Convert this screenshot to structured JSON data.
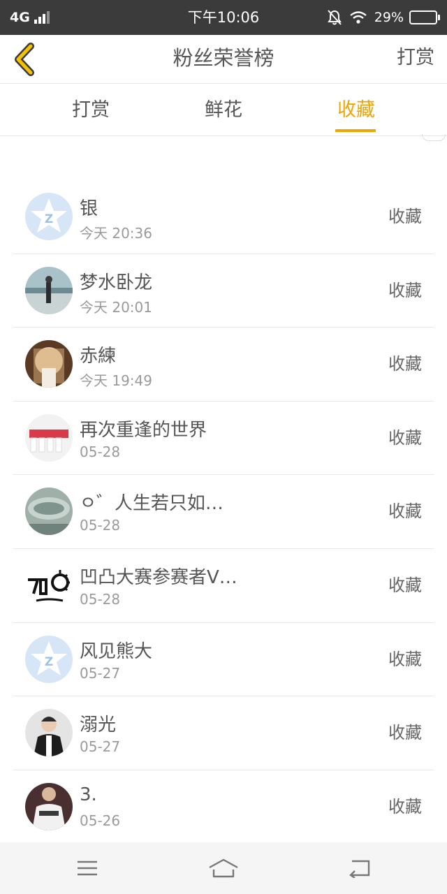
{
  "status_bar": {
    "network": "4G",
    "time": "下午10:06",
    "battery": "29%",
    "battery_level": 0.29,
    "icons": [
      "signal-icon",
      "bell-off-icon",
      "wifi-icon",
      "battery-icon"
    ]
  },
  "header": {
    "title": "粉丝荣誉榜",
    "right_link": "打赏",
    "back_icon": "chevron-left-icon"
  },
  "tabs": [
    {
      "label": "打赏",
      "active": false
    },
    {
      "label": "鲜花",
      "active": false
    },
    {
      "label": "收藏",
      "active": true
    }
  ],
  "list": [
    {
      "name": "银",
      "time": "今天 20:36",
      "action": "收藏",
      "avatar": "default-avatar"
    },
    {
      "name": "梦水卧龙",
      "time": "今天 20:01",
      "action": "收藏",
      "avatar": "photo-avatar"
    },
    {
      "name": "赤練",
      "time": "今天 19:49",
      "action": "收藏",
      "avatar": "photo-avatar"
    },
    {
      "name": "再次重逢的世界",
      "time": "05-28",
      "action": "收藏",
      "avatar": "photo-avatar"
    },
    {
      "name": "ㅇ゛人生若只如…",
      "time": "05-28",
      "action": "收藏",
      "avatar": "photo-avatar"
    },
    {
      "name": "凹凸大赛参赛者V…",
      "time": "05-28",
      "action": "收藏",
      "avatar": "logo-avatar"
    },
    {
      "name": "风见熊大",
      "time": "05-27",
      "action": "收藏",
      "avatar": "default-avatar"
    },
    {
      "name": "溺光",
      "time": "05-27",
      "action": "收藏",
      "avatar": "photo-avatar"
    },
    {
      "name": "3.",
      "time": "05-26",
      "action": "收藏",
      "avatar": "photo-avatar"
    }
  ],
  "bottom_nav": [
    "menu-icon",
    "home-icon",
    "return-icon"
  ],
  "colors": {
    "accent": "#f0a400",
    "status_bar_bg": "#3b3b3b",
    "text_primary": "#555555",
    "text_secondary": "#9a9a9a",
    "default_avatar_bg": "#d6e6f7"
  }
}
